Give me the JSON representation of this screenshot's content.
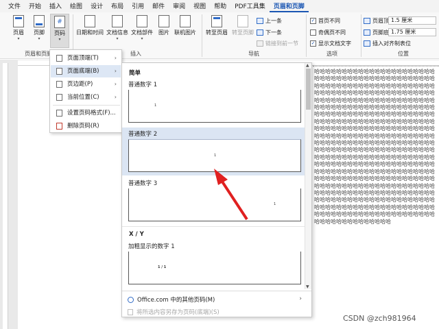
{
  "menubar": [
    "文件",
    "开始",
    "插入",
    "绘图",
    "设计",
    "布局",
    "引用",
    "邮件",
    "审阅",
    "视图",
    "帮助",
    "PDF工具集",
    "页眉和页脚"
  ],
  "menubar_active": "页眉和页脚",
  "ribbon": {
    "header": "页眉",
    "footer": "页脚",
    "pagenum": "页码",
    "group_hf": "页眉和页脚",
    "datetime": "日期和时间",
    "docinfo": "文档信息",
    "docparts": "文档部件",
    "picture": "图片",
    "online_pic": "联机图片",
    "group_insert": "插入",
    "goto_header": "转至页眉",
    "goto_footer": "转至页脚",
    "prev": "上一条",
    "next": "下一条",
    "link_prev": "链接到前一节",
    "group_nav": "导航",
    "opt_first": "首页不同",
    "opt_oddeven": "奇偶页不同",
    "opt_showtext": "显示文档文字",
    "group_options": "选项",
    "header_dist_label": "页眉顶端距离:",
    "header_dist": "1.5 厘米",
    "footer_dist_label": "页脚底端距离:",
    "footer_dist": "1.75 厘米",
    "insert_tab": "插入对齐制表位",
    "group_position": "位置"
  },
  "menu1": {
    "items": [
      "页面顶端(T)",
      "页面底端(B)",
      "页边距(P)",
      "当前位置(C)",
      "设置页码格式(F)...",
      "删除页码(R)"
    ]
  },
  "gallery": {
    "section1": "简单",
    "items": [
      {
        "label": "普通数字 1",
        "num": "1"
      },
      {
        "label": "普通数字 2",
        "num": "1"
      },
      {
        "label": "普通数字 3",
        "num": "1"
      }
    ],
    "section2": "X / Y",
    "item4": {
      "label": "加粗显示的数字 1",
      "num": "1 / 1"
    },
    "more": "Office.com 中的其他页码(M)",
    "save": "将所选内容另存为页码(底端)(S)"
  },
  "doc_text": "哈哈哈哈哈哈哈哈哈哈哈哈哈哈哈哈哈哈哈哈哈哈哈哈哈哈哈哈哈哈哈哈哈哈哈哈哈哈哈哈哈哈哈哈哈哈哈哈哈哈哈哈哈哈哈哈哈哈哈哈哈哈哈哈哈哈哈哈哈哈哈哈哈哈哈哈哈哈哈哈哈哈哈哈哈哈哈哈哈哈哈哈哈哈哈哈哈哈哈哈哈哈哈哈哈哈哈哈哈哈哈哈哈哈哈哈哈哈哈哈哈哈哈哈哈哈哈哈哈哈哈哈哈哈哈哈哈哈哈哈哈哈哈哈哈哈哈哈哈哈哈哈哈哈哈哈哈哈哈哈哈哈哈哈哈哈哈哈哈哈哈哈哈哈哈哈哈哈哈哈哈哈哈哈哈哈哈哈哈哈哈哈哈哈哈哈哈哈哈哈哈哈哈哈哈哈哈哈哈哈哈哈哈哈哈哈哈哈哈哈哈哈哈哈哈哈哈哈哈哈哈哈哈哈哈哈哈哈哈哈哈哈哈哈哈哈哈哈哈哈哈哈哈哈哈哈哈哈哈哈哈哈哈哈哈哈哈哈哈哈哈哈哈哈哈哈哈哈哈哈哈哈哈哈哈哈哈哈哈哈哈哈哈哈哈哈哈哈哈哈哈哈哈哈哈哈哈哈哈哈哈哈哈哈哈哈哈哈哈哈哈哈哈哈哈哈哈哈哈哈哈哈哈哈哈哈哈哈哈哈哈哈哈哈哈哈哈哈哈哈哈哈哈哈哈哈哈哈哈哈哈哈哈哈哈哈哈哈哈哈哈哈哈哈哈哈哈哈哈哈哈哈哈哈哈哈哈哈哈哈哈哈哈哈哈哈哈哈哈哈哈哈哈哈哈哈哈哈哈哈哈哈哈哈哈哈哈哈哈哈哈哈哈哈哈哈哈哈哈哈哈哈哈哈哈哈哈哈哈哈哈哈哈哈哈哈哈哈哈哈哈哈哈哈哈哈哈哈哈哈哈哈哈哈哈哈哈哈哈哈哈哈哈哈哈哈",
  "watermark": "CSDN @zch981964",
  "colors": {
    "accent": "#1a56b3",
    "highlight": "#dbe5f3",
    "arrow": "#e02020"
  }
}
